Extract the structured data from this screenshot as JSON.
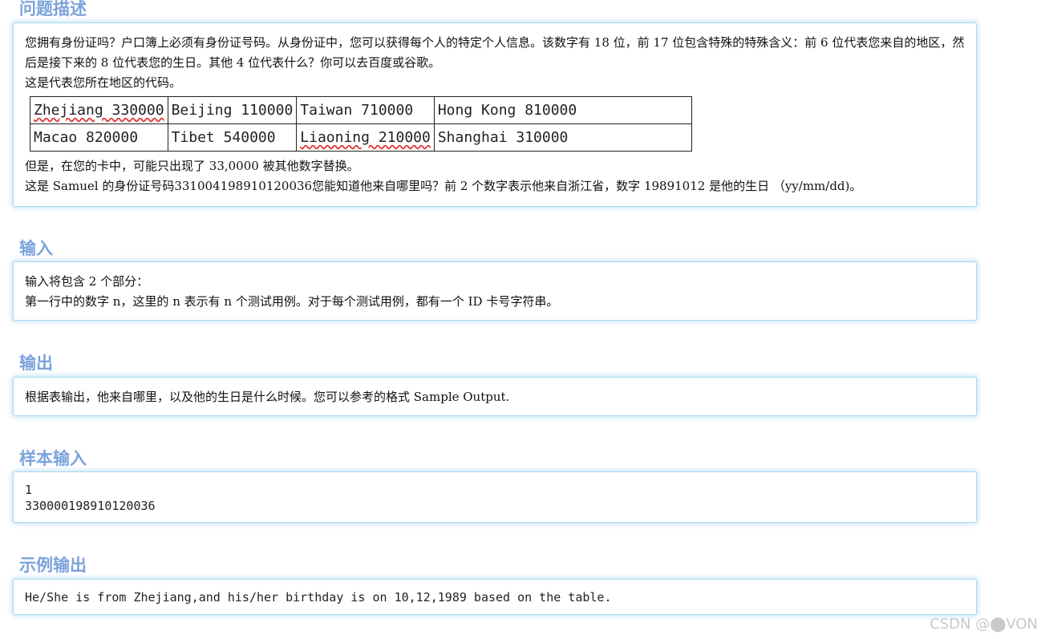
{
  "sections": {
    "description": {
      "title": "问题描述",
      "para1": "您拥有身份证吗？户口簿上必须有身份证号码。从身份证中，您可以获得每个人的特定个人信息。该数字有 18 位，前 17 位包含特殊的特殊含义：前 6 位代表您来自的地区，然后是接下来的 8 位代表您的生日。其他 4 位代表什么？你可以去百度或谷歌。",
      "para2": "这是代表您所在地区的代码。",
      "table": [
        [
          "Zhejiang 330000",
          "Beijing 110000",
          "Taiwan 710000",
          "Hong Kong 810000"
        ],
        [
          "Macao 820000",
          "Tibet 540000",
          "Liaoning 210000",
          "Shanghai 310000"
        ]
      ],
      "para3": "但是，在您的卡中，可能只出现了 33,0000 被其他数字替换。",
      "para4": "这是 Samuel 的身份证号码331004198910120036您能知道他来自哪里吗？前 2 个数字表示他来自浙江省，数字 19891012 是他的生日 （yy/mm/dd)。"
    },
    "input": {
      "title": "输入",
      "line1": "输入将包含 2 个部分：",
      "line2": "第一行中的数字 n，这里的 n 表示有 n 个测试用例。对于每个测试用例，都有一个 ID 卡号字符串。"
    },
    "output": {
      "title": "输出",
      "line1": "根据表输出，他来自哪里，以及他的生日是什么时候。您可以参考的格式 Sample Output."
    },
    "sample_input": {
      "title": "样本输入",
      "line1": "1",
      "line2": "330000198910120036"
    },
    "sample_output": {
      "title": "示例输出",
      "line1": "He/She is from Zhejiang,and his/her birthday is on 10,12,1989 based on the table."
    }
  },
  "watermark": "CSDN @⬤VON"
}
